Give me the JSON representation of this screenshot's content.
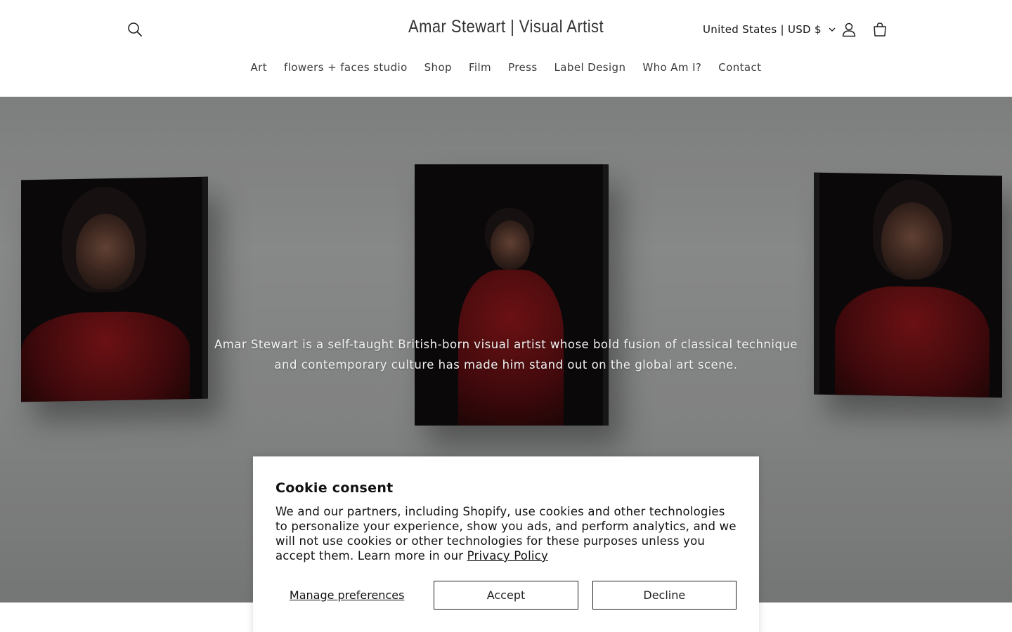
{
  "header": {
    "site_title": "Amar Stewart | Visual Artist",
    "currency": "United States | USD $"
  },
  "nav": {
    "items": [
      "Art",
      "flowers + faces studio",
      "Shop",
      "Film",
      "Press",
      "Label Design",
      "Who Am I?",
      "Contact"
    ]
  },
  "hero": {
    "text": "Amar Stewart is a self-taught British-born visual artist whose bold fusion of classical technique and contemporary culture has made him stand out on the global art scene."
  },
  "cookie_banner": {
    "title": "Cookie consent",
    "body": "We and our partners, including Shopify, use cookies and other technologies to personalize your experience, show you ads, and perform analytics, and we will not use cookies or other technologies for these purposes unless you accept them. Learn more in our ",
    "privacy_link": "Privacy Policy",
    "manage_label": "Manage preferences",
    "accept_label": "Accept",
    "decline_label": "Decline"
  },
  "icons": {
    "search": "search-icon",
    "chevron": "chevron-down-icon",
    "account": "account-icon",
    "cart": "cart-icon"
  }
}
